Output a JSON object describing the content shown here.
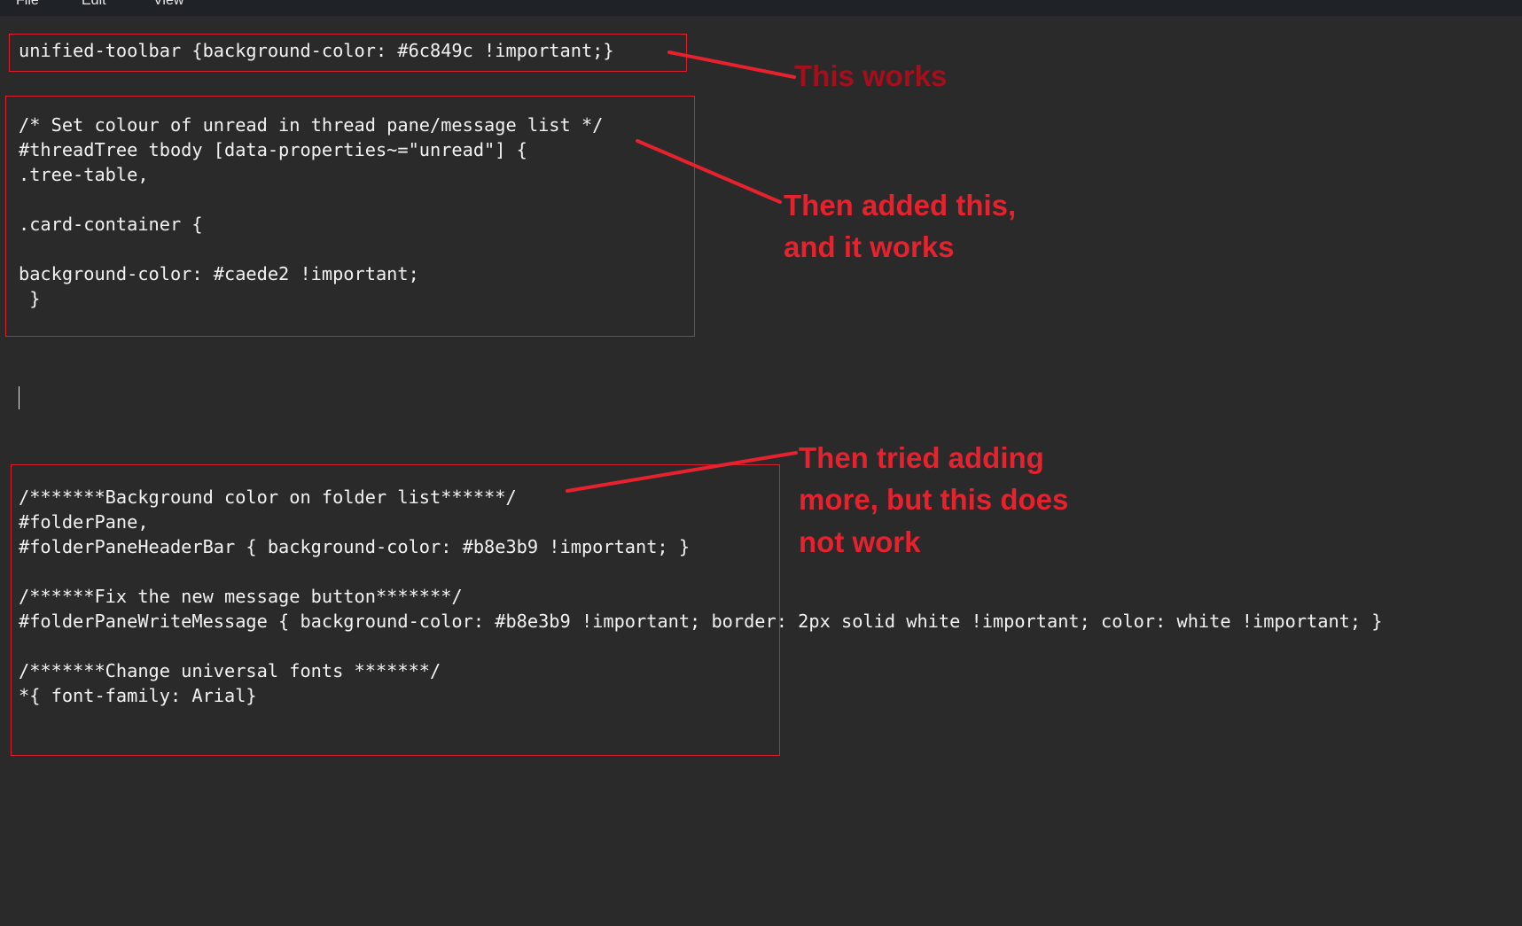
{
  "menu": {
    "items": [
      "File",
      "Edit",
      "View"
    ]
  },
  "editor": {
    "lines": [
      "unified-toolbar {background-color: #6c849c !important;}",
      "/* Set colour of unread in thread pane/message list */",
      "#threadTree tbody [data-properties~=\"unread\"] {",
      ".tree-table,",
      ".card-container {",
      "background-color: #caede2 !important;",
      " }",
      "/*******Background color on folder list******/",
      "#folderPane,",
      "#folderPaneHeaderBar { background-color: #b8e3b9 !important; }",
      "/******Fix the new message button*******/",
      "#folderPaneWriteMessage { background-color: #b8e3b9 !important; border: 2px solid white !important; color: white !important; }",
      "/*******Change universal fonts *******/",
      "*{ font-family: Arial}"
    ]
  },
  "annotations": {
    "note_1": "This works",
    "note_2": [
      "Then added this,",
      "and it works"
    ],
    "note_3": [
      "Then tried adding",
      "more, but this does",
      "not work"
    ],
    "color": "#e5222e"
  }
}
